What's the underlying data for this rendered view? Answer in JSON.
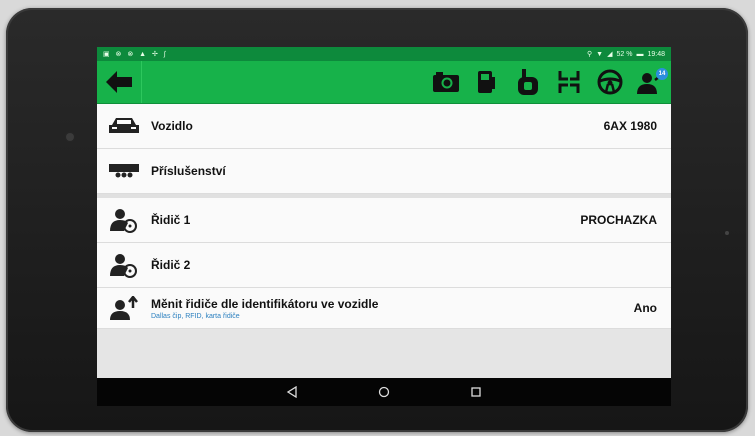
{
  "status_bar": {
    "left_icons": "▣ ⊗ ⊗ ▲ ✢ ∫",
    "battery": "52 %",
    "time": "19:48"
  },
  "toolbar": {
    "badge_count": "14",
    "icons": [
      "camera-icon",
      "fuel-icon",
      "tachograph-icon",
      "grid-icon",
      "steering-wheel-icon",
      "driver-icon"
    ]
  },
  "rows": {
    "vehicle": {
      "label": "Vozidlo",
      "value": "6AX 1980"
    },
    "accessories": {
      "label": "Příslušenství"
    },
    "driver1": {
      "label": "Řidič 1",
      "value": "PROCHAZKA"
    },
    "driver2": {
      "label": "Řidič 2"
    },
    "change_driver": {
      "label": "Měnit řidiče dle identifikátoru ve vozidle",
      "sub": "Dallas čip, RFID, karta řidiče",
      "value": "Ano"
    }
  },
  "colors": {
    "toolbar": "#17b24a",
    "statusbar": "#0d8a3c",
    "accent_blue": "#2a7fbf"
  }
}
